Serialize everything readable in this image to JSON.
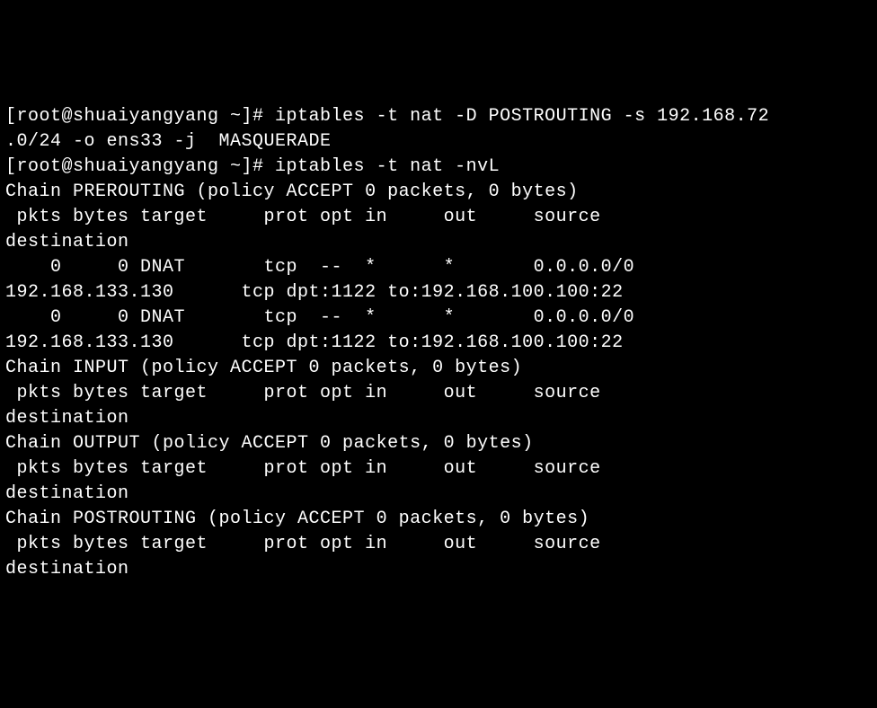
{
  "terminal": {
    "lines": [
      {
        "type": "prompt",
        "prompt": "[root@shuaiyangyang ~]# ",
        "command": "iptables -t nat -D POSTROUTING -s 192.168.72"
      },
      {
        "type": "output",
        "text": ".0/24 -o ens33 -j  MASQUERADE"
      },
      {
        "type": "prompt",
        "prompt": "[root@shuaiyangyang ~]# ",
        "command": "iptables -t nat -nvL"
      },
      {
        "type": "output",
        "text": "Chain PREROUTING (policy ACCEPT 0 packets, 0 bytes)"
      },
      {
        "type": "output",
        "text": " pkts bytes target     prot opt in     out     source          "
      },
      {
        "type": "output",
        "text": "destination"
      },
      {
        "type": "output",
        "text": "    0     0 DNAT       tcp  --  *      *       0.0.0.0/0        "
      },
      {
        "type": "output",
        "text": "192.168.133.130      tcp dpt:1122 to:192.168.100.100:22"
      },
      {
        "type": "output",
        "text": "    0     0 DNAT       tcp  --  *      *       0.0.0.0/0        "
      },
      {
        "type": "output",
        "text": "192.168.133.130      tcp dpt:1122 to:192.168.100.100:22"
      },
      {
        "type": "output",
        "text": ""
      },
      {
        "type": "output",
        "text": "Chain INPUT (policy ACCEPT 0 packets, 0 bytes)"
      },
      {
        "type": "output",
        "text": " pkts bytes target     prot opt in     out     source          "
      },
      {
        "type": "output",
        "text": "destination"
      },
      {
        "type": "output",
        "text": ""
      },
      {
        "type": "output",
        "text": "Chain OUTPUT (policy ACCEPT 0 packets, 0 bytes)"
      },
      {
        "type": "output",
        "text": " pkts bytes target     prot opt in     out     source          "
      },
      {
        "type": "output",
        "text": "destination"
      },
      {
        "type": "output",
        "text": ""
      },
      {
        "type": "output",
        "text": "Chain POSTROUTING (policy ACCEPT 0 packets, 0 bytes)"
      },
      {
        "type": "output",
        "text": " pkts bytes target     prot opt in     out     source          "
      },
      {
        "type": "output",
        "text": "destination"
      }
    ]
  }
}
